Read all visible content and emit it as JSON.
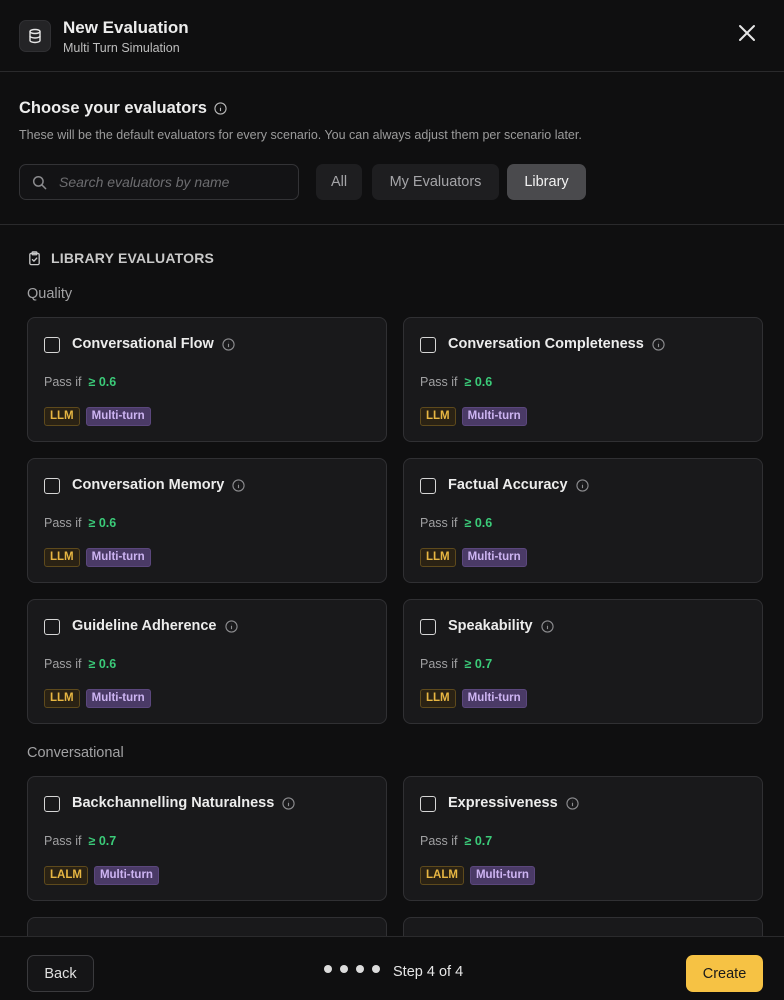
{
  "header": {
    "title": "New Evaluation",
    "subtitle": "Multi Turn Simulation",
    "icon": "database-icon",
    "close_icon": "close-icon"
  },
  "chooser": {
    "title": "Choose your evaluators",
    "description": "These will be the default evaluators for every scenario. You can always adjust them per scenario later.",
    "search_placeholder": "Search evaluators by name",
    "search_value": "",
    "filters": [
      {
        "label": "All",
        "active": false
      },
      {
        "label": "My Evaluators",
        "active": false
      },
      {
        "label": "Library",
        "active": true
      }
    ]
  },
  "library": {
    "heading": "LIBRARY EVALUATORS",
    "groups": [
      {
        "label": "Quality",
        "cards": [
          {
            "name": "Conversational Flow",
            "pass_label": "Pass if",
            "threshold": "≥ 0.6",
            "tags": [
              "LLM",
              "Multi-turn"
            ],
            "checked": false
          },
          {
            "name": "Conversation Completeness",
            "pass_label": "Pass if",
            "threshold": "≥ 0.6",
            "tags": [
              "LLM",
              "Multi-turn"
            ],
            "checked": false
          },
          {
            "name": "Conversation Memory",
            "pass_label": "Pass if",
            "threshold": "≥ 0.6",
            "tags": [
              "LLM",
              "Multi-turn"
            ],
            "checked": false
          },
          {
            "name": "Factual Accuracy",
            "pass_label": "Pass if",
            "threshold": "≥ 0.6",
            "tags": [
              "LLM",
              "Multi-turn"
            ],
            "checked": false
          },
          {
            "name": "Guideline Adherence",
            "pass_label": "Pass if",
            "threshold": "≥ 0.6",
            "tags": [
              "LLM",
              "Multi-turn"
            ],
            "checked": false
          },
          {
            "name": "Speakability",
            "pass_label": "Pass if",
            "threshold": "≥ 0.7",
            "tags": [
              "LLM",
              "Multi-turn"
            ],
            "checked": false
          }
        ]
      },
      {
        "label": "Conversational",
        "cards": [
          {
            "name": "Backchannelling Naturalness",
            "pass_label": "Pass if",
            "threshold": "≥ 0.7",
            "tags": [
              "LALM",
              "Multi-turn"
            ],
            "checked": false
          },
          {
            "name": "Expressiveness",
            "pass_label": "Pass if",
            "threshold": "≥ 0.7",
            "tags": [
              "LALM",
              "Multi-turn"
            ],
            "checked": false
          }
        ]
      }
    ]
  },
  "footer": {
    "back_label": "Back",
    "step_text": "Step 4 of 4",
    "step_count": 4,
    "current_step": 4,
    "create_label": "Create"
  },
  "colors": {
    "accent": "#f6c244",
    "pass_threshold": "#3bcb79",
    "tag_llm": "#e7b642",
    "tag_multiturn": "#cdb4f2"
  }
}
